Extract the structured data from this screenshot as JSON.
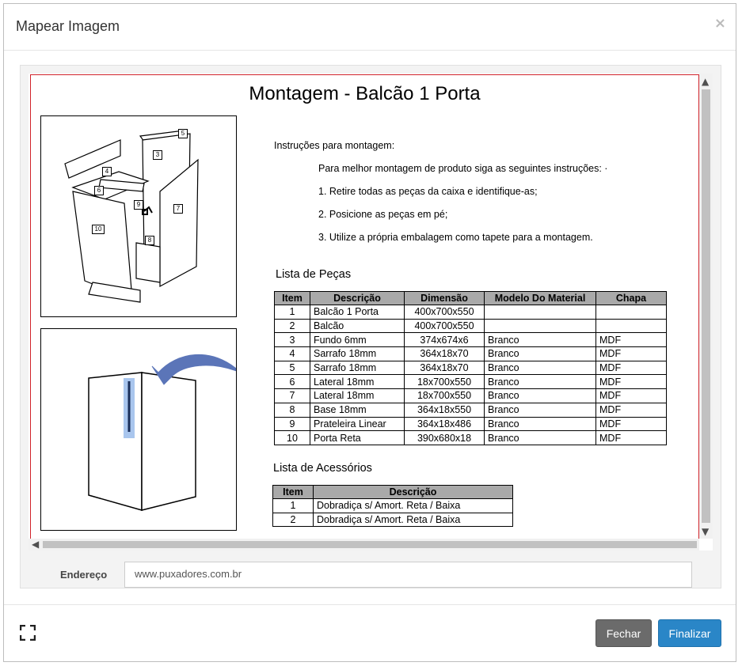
{
  "modal": {
    "title": "Mapear Imagem",
    "close_label": "×"
  },
  "document": {
    "title": "Montagem - Balcão 1 Porta",
    "instructions": {
      "heading": "Instruções para montagem:",
      "intro": "Para melhor montagem de produto siga as seguintes instruções: ·",
      "steps": [
        "1. Retire todas as peças da caixa e identifique-as;",
        "2. Posicione as peças em pé;",
        "3. Utilize a própria embalagem  como tapete para a montagem."
      ]
    },
    "pecas": {
      "title": "Lista de Peças",
      "headers": [
        "Item",
        "Descrição",
        "Dimensão",
        "Modelo Do Material",
        "Chapa"
      ],
      "rows": [
        [
          "1",
          "Balcão 1 Porta",
          "400x700x550",
          "",
          ""
        ],
        [
          "2",
          "Balcão",
          "400x700x550",
          "",
          ""
        ],
        [
          "3",
          "Fundo 6mm",
          "374x674x6",
          "Branco",
          "MDF"
        ],
        [
          "4",
          "Sarrafo 18mm",
          "364x18x70",
          "Branco",
          "MDF"
        ],
        [
          "5",
          "Sarrafo 18mm",
          "364x18x70",
          "Branco",
          "MDF"
        ],
        [
          "6",
          "Lateral 18mm",
          "18x700x550",
          "Branco",
          "MDF"
        ],
        [
          "7",
          "Lateral 18mm",
          "18x700x550",
          "Branco",
          "MDF"
        ],
        [
          "8",
          "Base 18mm",
          "364x18x550",
          "Branco",
          "MDF"
        ],
        [
          "9",
          "Prateleira Linear",
          "364x18x486",
          "Branco",
          "MDF"
        ],
        [
          "10",
          "Porta Reta",
          "390x680x18",
          "Branco",
          "MDF"
        ]
      ]
    },
    "acessorios": {
      "title": "Lista de Acessórios",
      "headers": [
        "Item",
        "Descrição"
      ],
      "rows": [
        [
          "1",
          "Dobradiça s/ Amort. Reta / Baixa"
        ],
        [
          "2",
          "Dobradiça s/ Amort. Reta / Baixa"
        ]
      ]
    },
    "diagram_labels": [
      "5",
      "3",
      "4",
      "6",
      "9",
      "7",
      "10",
      "8"
    ]
  },
  "address": {
    "label": "Endereço",
    "value": "www.puxadores.com.br"
  },
  "buttons": {
    "close": "Fechar",
    "finish": "Finalizar"
  },
  "colors": {
    "doc_border": "#d0222a",
    "primary": "#2a86c7",
    "secondary": "#6b6b6b",
    "table_header": "#a9a9a9"
  }
}
